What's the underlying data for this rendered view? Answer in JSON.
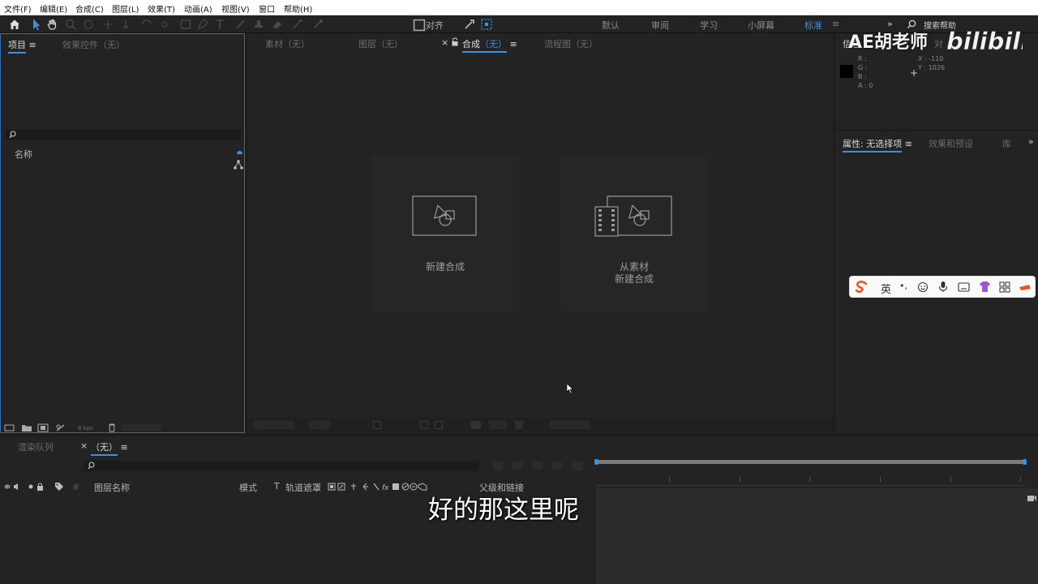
{
  "menu": {
    "items": [
      "文件(F)",
      "编辑(E)",
      "合成(C)",
      "图层(L)",
      "效果(T)",
      "动画(A)",
      "视图(V)",
      "窗口",
      "帮助(H)"
    ]
  },
  "toolbar": {
    "align_label": "对齐",
    "workspaces": [
      "默认",
      "审阅",
      "学习",
      "小屏幕",
      "标准"
    ],
    "active_workspace": "标准",
    "search_help": "搜索帮助"
  },
  "project_panel": {
    "tab_project": "项目",
    "tab_effects": "效果控件（无）",
    "column_name": "名称",
    "bpc": "8 bpc"
  },
  "viewer": {
    "tabs": [
      "素材（无）",
      "图层（无）",
      "合成",
      "（无）",
      "流程图（无）"
    ],
    "close_mark": "×",
    "new_comp_label": "新建合成",
    "from_footage_line1": "从素材",
    "from_footage_line2": "新建合成"
  },
  "info_panel": {
    "tab_info": "信息",
    "tab_audio": "对",
    "r_label": "R :",
    "g_label": "G :",
    "b_label": "B :",
    "a_label": "A : 0",
    "x_label": "X : -110",
    "y_label": "Y : 1026"
  },
  "properties_panel": {
    "tab_properties": "属性: 无选择项",
    "tab_effects_presets": "效果和预设",
    "tab_library": "库"
  },
  "timeline": {
    "tab_render_queue": "渲染队列",
    "tab_comp": "（无）",
    "close_mark": "×",
    "col_layer_name": "图层名称",
    "col_mode": "模式",
    "col_t": "T",
    "col_track_matte": "轨道遮罩",
    "col_parent": "父级和链接"
  },
  "ime": {
    "lang": "英"
  },
  "watermark": {
    "author": "AE胡老师",
    "site": "bilibili"
  },
  "subtitle": "好的那这里呢",
  "colors": {
    "accent": "#3d8fe0",
    "panel_bg": "#232323",
    "border_active": "#2f6fb5"
  }
}
